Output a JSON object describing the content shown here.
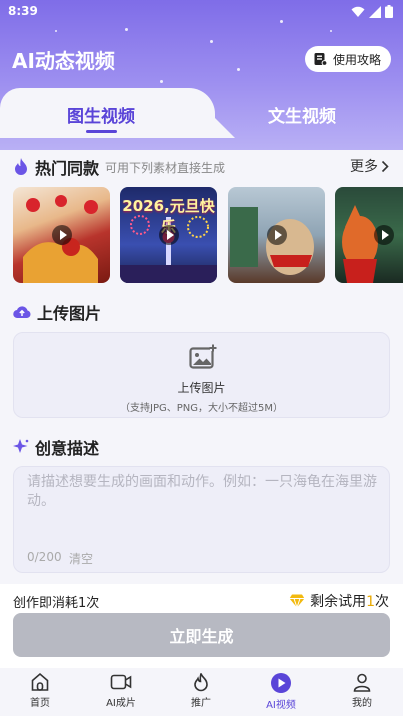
{
  "status": {
    "time": "8:39"
  },
  "header": {
    "title": "AI动态视频",
    "guide_label": "使用攻略"
  },
  "tabs": [
    {
      "label": "图生视频",
      "active": true
    },
    {
      "label": "文生视频",
      "active": false
    }
  ],
  "hot": {
    "title": "热门同款",
    "subtitle": "可用下列素材直接生成",
    "more_label": "更多",
    "items": [
      {
        "name": "lion-dance",
        "caption": ""
      },
      {
        "name": "new-year",
        "caption": "2026,元旦快乐"
      },
      {
        "name": "cat-scarf",
        "caption": ""
      },
      {
        "name": "fox-xmas",
        "caption": ""
      }
    ]
  },
  "upload": {
    "title": "上传图片",
    "label": "上传图片",
    "hint": "（支持JPG、PNG，大小不超过5M）"
  },
  "description": {
    "title": "创意描述",
    "placeholder": "请描述想要生成的画面和动作。例如：一只海龟在海里游动。",
    "count": "0/200",
    "clear_label": "清空"
  },
  "footer": {
    "cost_note": "创作即消耗1次",
    "trial_prefix": "剩余试用",
    "trial_count": "1",
    "trial_suffix": "次",
    "generate_label": "立即生成"
  },
  "nav": [
    {
      "label": "首页",
      "icon": "home-icon",
      "active": false
    },
    {
      "label": "AI成片",
      "icon": "video-camera-icon",
      "active": false
    },
    {
      "label": "推广",
      "icon": "flame-icon",
      "active": false
    },
    {
      "label": "AI视频",
      "icon": "play-circle-icon",
      "active": true
    },
    {
      "label": "我的",
      "icon": "user-icon",
      "active": false
    }
  ],
  "colors": {
    "accent": "#5a45d8",
    "hero": "#8f7ff0",
    "trial": "#e8a800",
    "button_disabled": "#b7b9c2"
  }
}
